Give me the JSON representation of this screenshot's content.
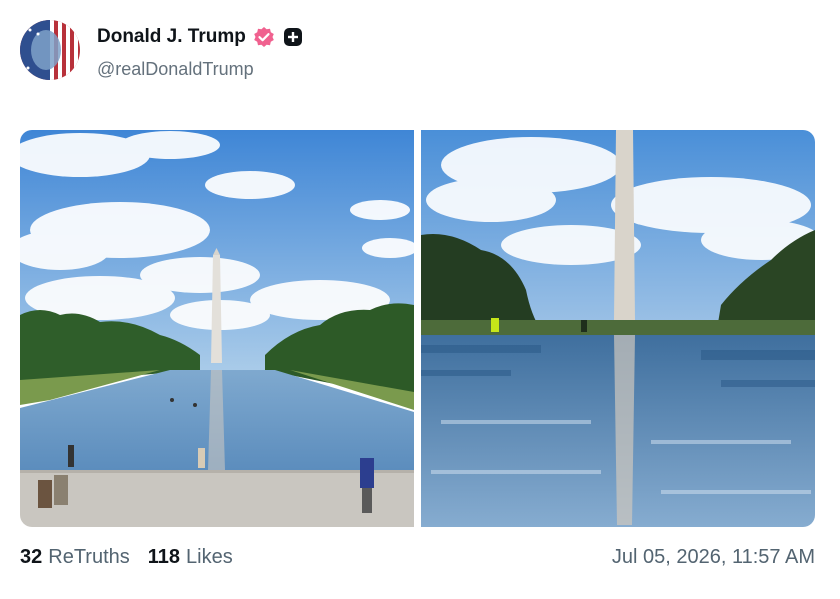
{
  "post": {
    "display_name": "Donald J. Trump",
    "handle": "@realDonaldTrump",
    "verified_icon": "verified-check-icon",
    "badge_icon": "plus-square-icon",
    "timestamp": "Jul 05, 2026, 11:57 AM"
  },
  "stats": {
    "retruths_count": "32",
    "retruths_label": "ReTruths",
    "likes_count": "118",
    "likes_label": "Likes"
  },
  "media": [
    {
      "name": "reflecting-pool-wide-photo"
    },
    {
      "name": "washington-monument-reflection-photo"
    }
  ],
  "colors": {
    "verified": "#f0618f",
    "sky": "#4a90d9",
    "water": "#5a8fc4"
  }
}
